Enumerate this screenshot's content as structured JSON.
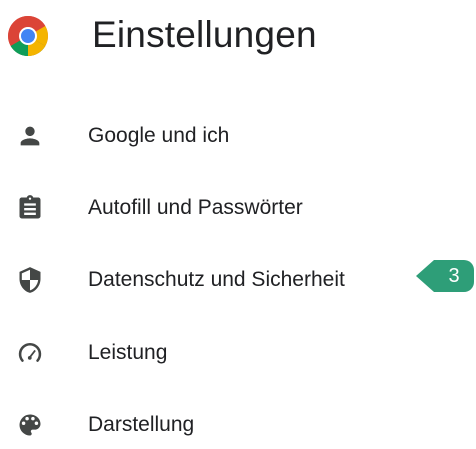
{
  "header": {
    "title": "Einstellungen",
    "logo_icon": "chrome-logo-icon"
  },
  "nav": {
    "items": [
      {
        "label": "Google und ich",
        "icon": "person-icon"
      },
      {
        "label": "Autofill und Passwörter",
        "icon": "clipboard-icon"
      },
      {
        "label": "Datenschutz und Sicherheit",
        "icon": "shield-icon"
      },
      {
        "label": "Leistung",
        "icon": "speedometer-icon"
      },
      {
        "label": "Darstellung",
        "icon": "palette-icon"
      }
    ]
  },
  "callout": {
    "number": "3",
    "color": "#2e9e78"
  },
  "colors": {
    "text": "#202124",
    "icon": "#444746"
  }
}
